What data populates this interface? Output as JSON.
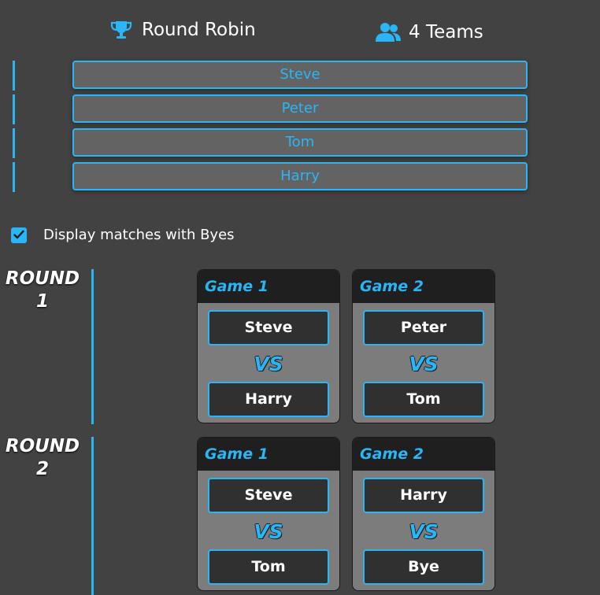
{
  "header": {
    "format_label": "Round Robin",
    "format_icon": "trophy-icon",
    "teams_label": "4 Teams",
    "teams_icon": "users-icon"
  },
  "teams": [
    {
      "name": "Steve"
    },
    {
      "name": "Peter"
    },
    {
      "name": "Tom"
    },
    {
      "name": "Harry"
    }
  ],
  "options": {
    "bye_label": "Display matches with Byes",
    "bye_checked": true
  },
  "vs_label": "VS",
  "rounds": [
    {
      "label": "ROUND 1",
      "games": [
        {
          "title": "Game 1",
          "home": "Steve",
          "away": "Harry"
        },
        {
          "title": "Game 2",
          "home": "Peter",
          "away": "Tom"
        }
      ]
    },
    {
      "label": "ROUND 2",
      "games": [
        {
          "title": "Game 1",
          "home": "Steve",
          "away": "Tom"
        },
        {
          "title": "Game 2",
          "home": "Harry",
          "away": "Bye"
        }
      ]
    }
  ],
  "colors": {
    "accent": "#29b6f6",
    "background": "#424242",
    "card": "#7c7c7c",
    "card_header": "#1f1f1f",
    "team_box": "#303030"
  }
}
